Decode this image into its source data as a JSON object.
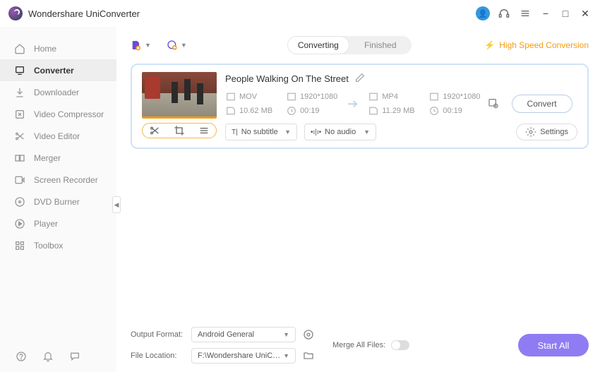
{
  "app": {
    "title": "Wondershare UniConverter"
  },
  "sidebar": {
    "items": [
      {
        "label": "Home"
      },
      {
        "label": "Converter"
      },
      {
        "label": "Downloader"
      },
      {
        "label": "Video Compressor"
      },
      {
        "label": "Video Editor"
      },
      {
        "label": "Merger"
      },
      {
        "label": "Screen Recorder"
      },
      {
        "label": "DVD Burner"
      },
      {
        "label": "Player"
      },
      {
        "label": "Toolbox"
      }
    ]
  },
  "tabs": {
    "converting": "Converting",
    "finished": "Finished"
  },
  "highspeed": "High Speed Conversion",
  "file": {
    "name": "People Walking On The Street",
    "src": {
      "format": "MOV",
      "res": "1920*1080",
      "size": "10.62 MB",
      "dur": "00:19"
    },
    "dst": {
      "format": "MP4",
      "res": "1920*1080",
      "size": "11.29 MB",
      "dur": "00:19"
    },
    "subtitle": "No subtitle",
    "audio": "No audio",
    "settings_label": "Settings",
    "convert_label": "Convert"
  },
  "footer": {
    "output_format_label": "Output Format:",
    "output_format_value": "Android General",
    "file_location_label": "File Location:",
    "file_location_value": "F:\\Wondershare UniConverter",
    "merge_label": "Merge All Files:",
    "start_all": "Start All"
  }
}
